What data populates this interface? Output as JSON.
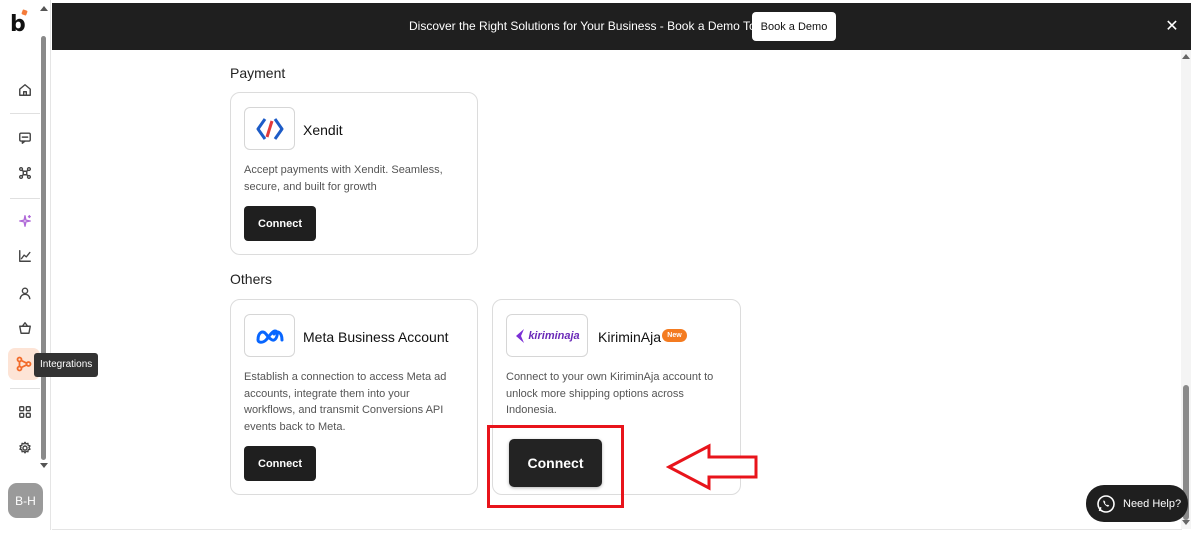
{
  "app": {
    "logo_text": "b"
  },
  "sidebar": {
    "tooltip": "Integrations",
    "avatar": "B-H",
    "items": [
      {
        "name": "home-icon"
      },
      {
        "name": "chat-icon"
      },
      {
        "name": "network-icon"
      },
      {
        "name": "sparkle-icon"
      },
      {
        "name": "chart-icon"
      },
      {
        "name": "user-icon"
      },
      {
        "name": "basket-icon"
      },
      {
        "name": "integrations-icon"
      },
      {
        "name": "apps-grid-icon"
      },
      {
        "name": "gear-icon"
      }
    ]
  },
  "banner": {
    "text": "Discover the Right Solutions for Your Business - Book a Demo Today!",
    "button": "Book a Demo",
    "close": "✕"
  },
  "sections": {
    "payment": {
      "title": "Payment",
      "cards": [
        {
          "name": "Xendit",
          "description_lines": [
            "Accept payments with Xendit. Seamless,",
            "secure, and built for growth"
          ],
          "button": "Connect"
        }
      ]
    },
    "others": {
      "title": "Others",
      "cards": [
        {
          "name": "Meta Business Account",
          "description_lines": [
            "Establish a connection to access Meta ad",
            "accounts, integrate them into your",
            "workflows, and transmit Conversions API",
            "events back to Meta."
          ],
          "button": "Connect"
        },
        {
          "name": "KiriminAja",
          "logo_text": "kiriminaja",
          "badge": "New",
          "description_lines": [
            "Connect to your own KiriminAja account to",
            "unlock more shipping options across",
            "Indonesia."
          ],
          "button": "Connect"
        }
      ]
    }
  },
  "help": {
    "label": "Need Help?"
  },
  "colors": {
    "accent": "#f26b2a",
    "annotation": "#e8141b",
    "dark": "#1f1f1f"
  }
}
